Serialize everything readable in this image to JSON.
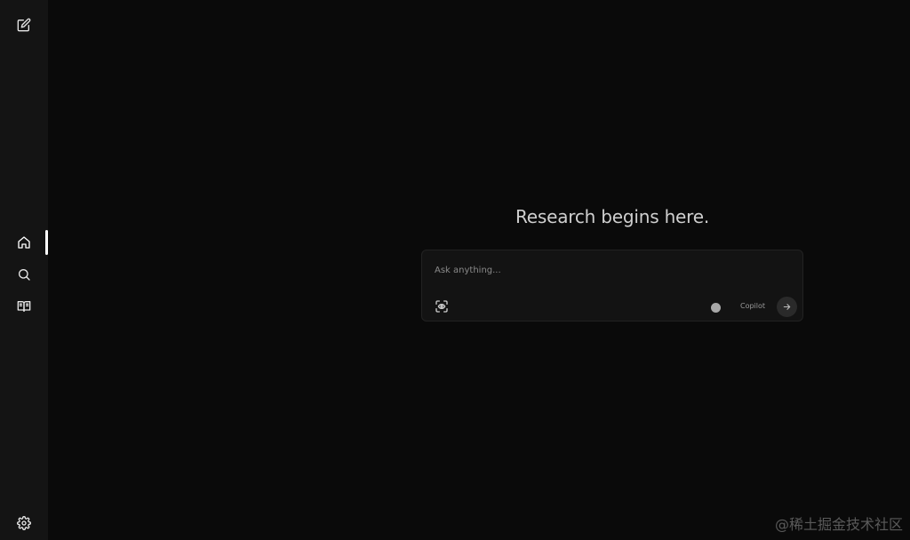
{
  "sidebar": {
    "items": [
      {
        "name": "new-thread",
        "icon": "edit-icon"
      },
      {
        "name": "home",
        "icon": "home-icon",
        "active": true
      },
      {
        "name": "discover",
        "icon": "search-icon"
      },
      {
        "name": "library",
        "icon": "book-icon"
      },
      {
        "name": "settings",
        "icon": "gear-icon"
      }
    ]
  },
  "main": {
    "headline": "Research begins here.",
    "ask": {
      "placeholder": "Ask anything...",
      "value": "",
      "focus_icon": "focus-scan-icon",
      "copilot_label": "Copilot",
      "copilot_enabled": false,
      "submit_icon": "arrow-right-icon"
    }
  },
  "watermark": "@稀土掘金技术社区",
  "colors": {
    "background": "#0a0a0a",
    "sidebar": "#141414",
    "box": "#131313",
    "text": "#cfcfcf",
    "muted": "#8a8a8a"
  }
}
